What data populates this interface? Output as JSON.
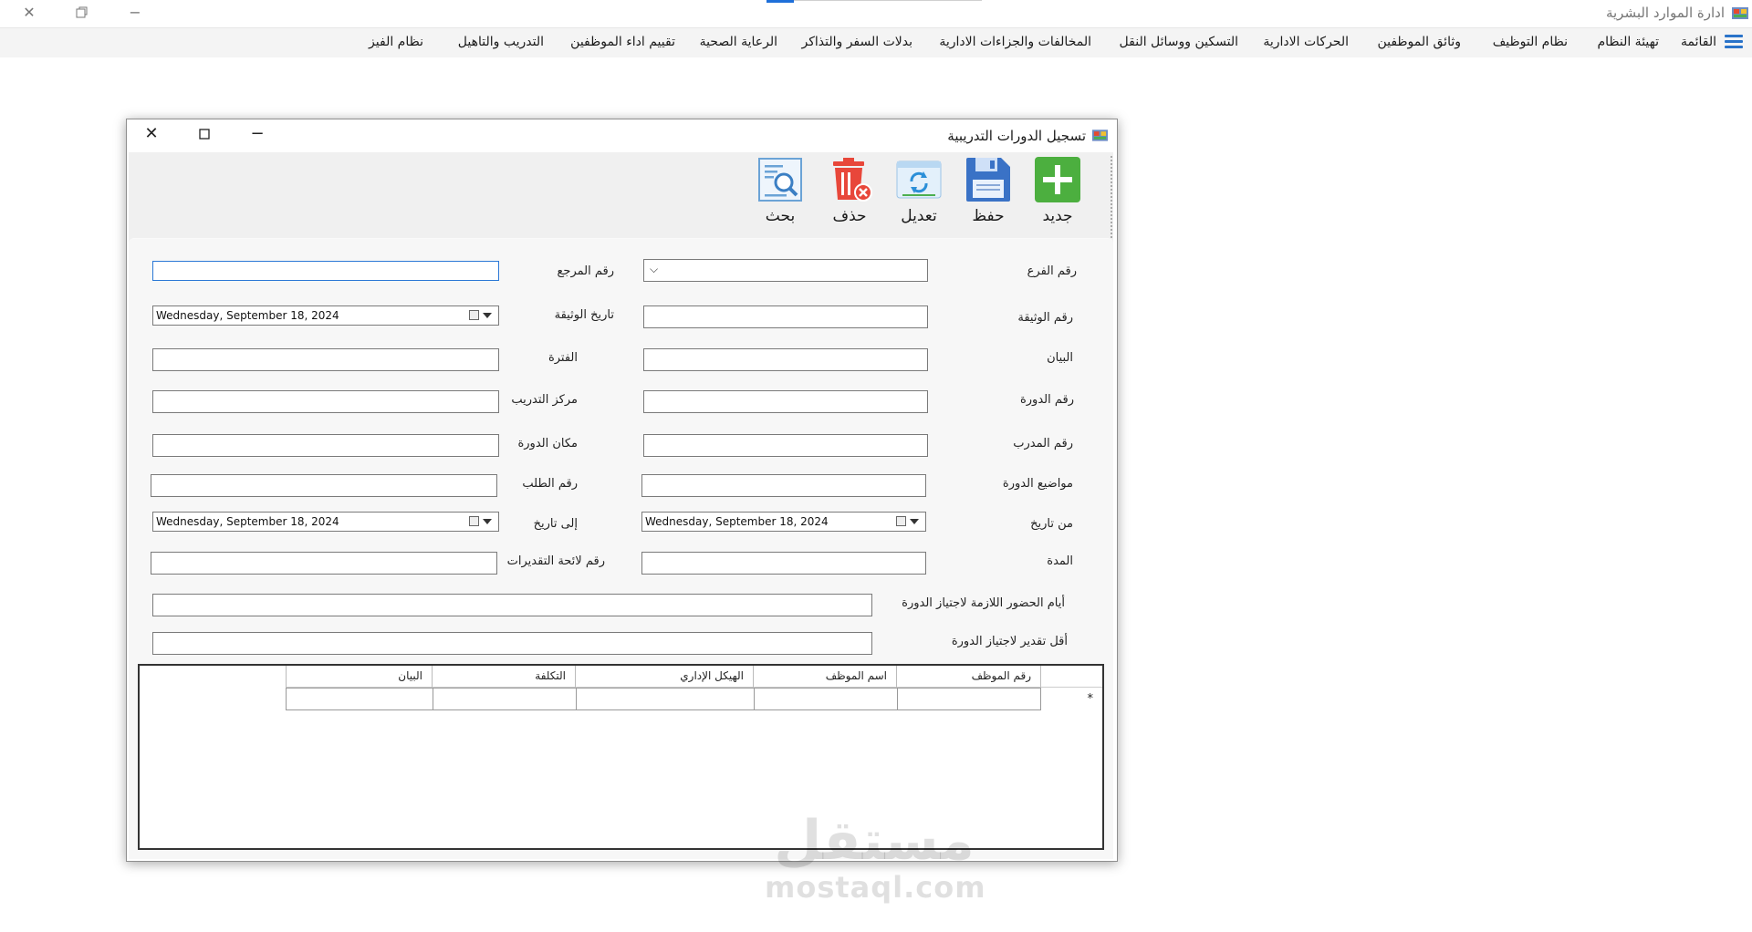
{
  "app": {
    "title": "ادارة الموارد البشرية"
  },
  "menu": {
    "items": [
      "القائمة",
      "تهيئة النظام",
      "نظام التوظيف",
      "وثائق الموظفين",
      "الحركات الادارية",
      "التسكين ووسائل النقل",
      "المخالفات والجزاءات الادارية",
      "بدلات السفر والتذاكر",
      "الرعاية الصحية",
      "تقييم اداء الموظفين",
      "التدريب والتاهيل",
      "نظام الفيز"
    ]
  },
  "window": {
    "title": "تسجيل الدورات التدريبية"
  },
  "toolbar": {
    "new": "جديد",
    "save": "حفظ",
    "edit": "تعديل",
    "delete": "حذف",
    "search": "بحث"
  },
  "form": {
    "branch_no": "رقم الفرع",
    "reference_no": "رقم المرجع",
    "document_no": "رقم الوثيقة",
    "document_date": "تاريخ الوثيقة",
    "document_date_value": "Wednesday, September 18, 2024",
    "statement": "البيان",
    "period": "الفترة",
    "course_no": "رقم الدورة",
    "training_center": "مركز التدريب",
    "trainer_no": "رقم المدرب",
    "course_place": "مكان الدورة",
    "course_topics": "مواضيع الدورة",
    "request_no": "رقم الطلب",
    "from_date": "من تاريخ",
    "from_date_value": "Wednesday, September 18, 2024",
    "to_date": "إلى تاريخ",
    "to_date_value": "Wednesday, September 18, 2024",
    "duration": "المدة",
    "grades_list_no": "رقم لائحة التقديرات",
    "attendance_days": "أيام الحضور اللازمة لاجتياز الدورة",
    "min_grade": "أقل تقدير لاجتياز الدورة"
  },
  "grid": {
    "columns": [
      "رقم  الموظف",
      "اسم الموظف",
      "الهيكل الإداري",
      "التكلفة",
      "البيان"
    ],
    "new_row_marker": "*"
  },
  "watermark": {
    "arabic": "مستقل",
    "latin": "mostaql.com"
  }
}
